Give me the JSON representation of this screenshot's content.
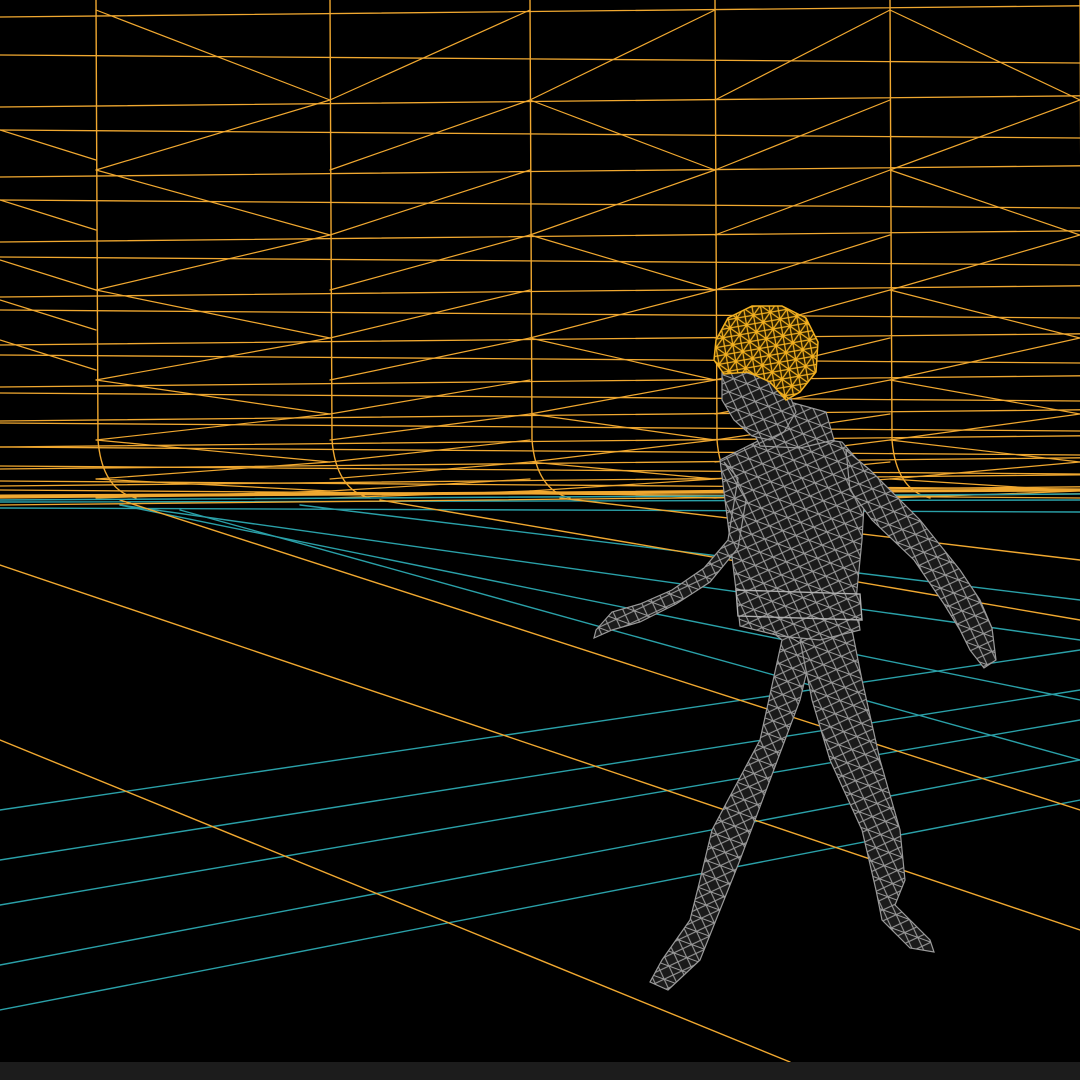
{
  "viewport": {
    "background": "#000000",
    "backdrop_wire_color": "#f0a830",
    "floor_wire_color": "#2aa0a8",
    "figure_wire_color": "#9a9a9a",
    "hair_wire_color": "#f2b020"
  },
  "status_bar": {
    "color": "#1c1c1c"
  }
}
